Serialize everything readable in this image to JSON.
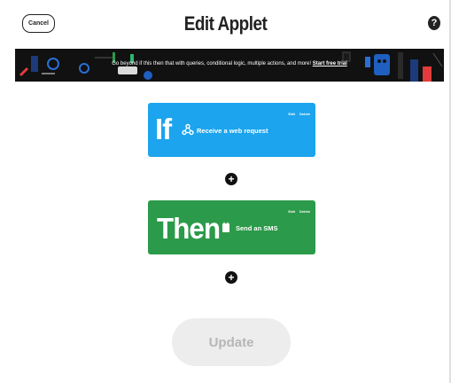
{
  "header": {
    "cancel_label": "Cancel",
    "title": "Edit Applet",
    "help_label": "?"
  },
  "banner": {
    "text": "Go beyond if this then that with queries, conditional logic, multiple actions, and more!",
    "link_label": "Start free trial"
  },
  "trigger": {
    "keyword": "If",
    "service_icon": "webhooks-icon",
    "label": "Receive a web request",
    "edit_label": "Edit",
    "delete_label": "Delete",
    "color": "#1ca4ee"
  },
  "action": {
    "keyword": "Then",
    "service_icon": "sms-icon",
    "label": "Send an SMS",
    "edit_label": "Edit",
    "delete_label": "Delete",
    "color": "#2b9a4a"
  },
  "connectors": [
    "+",
    "+"
  ],
  "footer": {
    "update_label": "Update"
  }
}
